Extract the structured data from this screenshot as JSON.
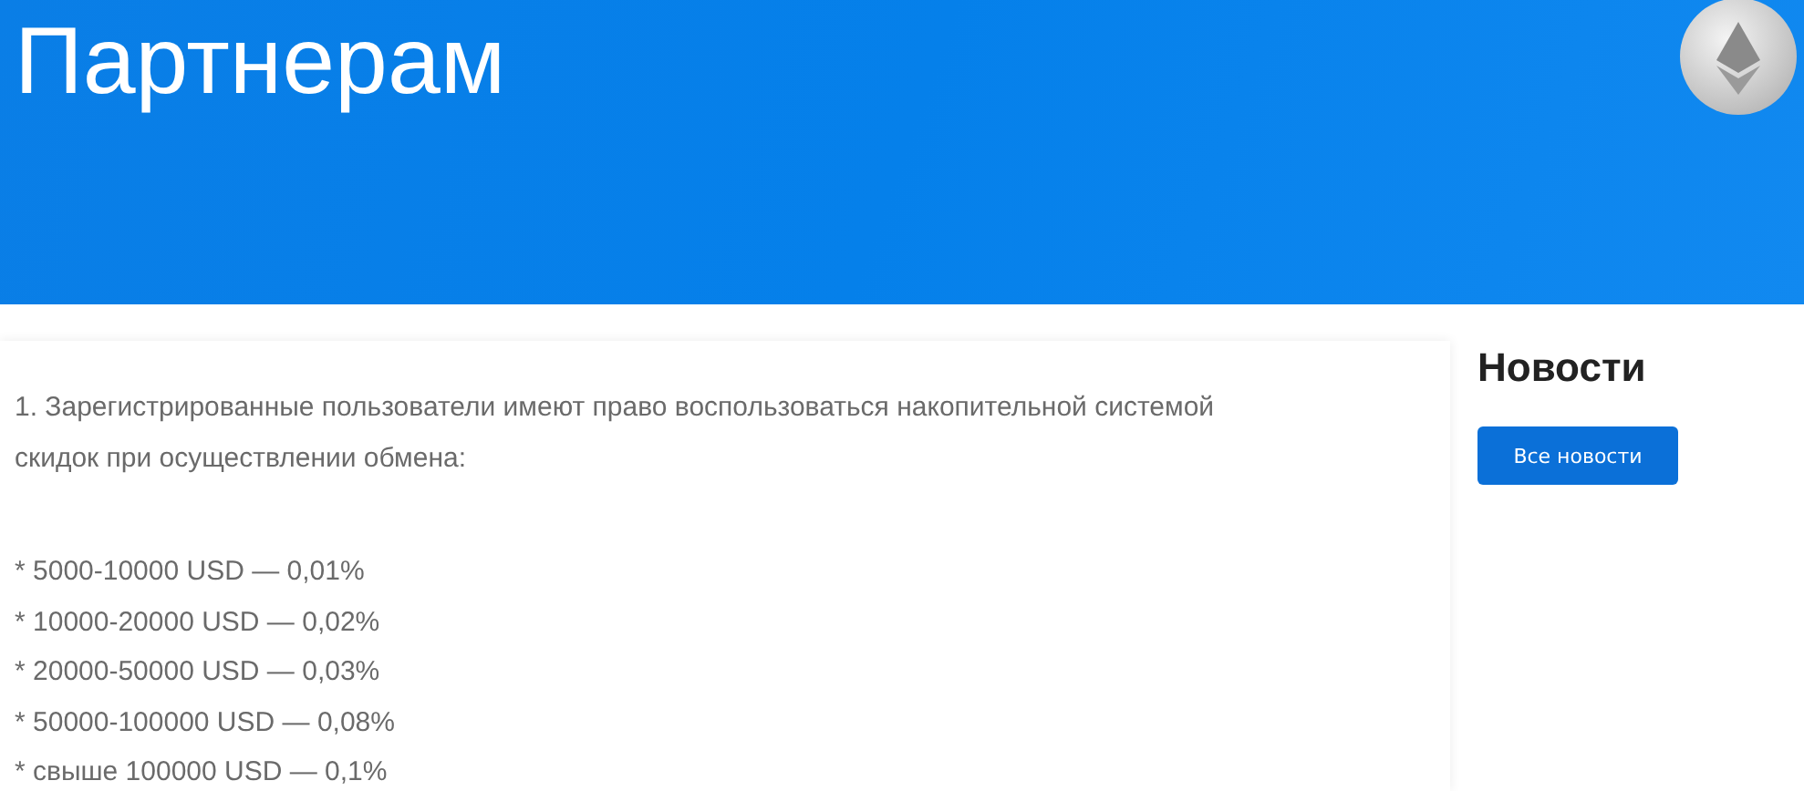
{
  "header": {
    "title": "Партнерам"
  },
  "content": {
    "paragraph": "1. Зарегистрированные пользователи имеют право воспользоваться накопительной системой скидок при осуществлении обмена:",
    "items": [
      "* 5000-10000 USD — 0,01%",
      "* 10000-20000 USD — 0,02%",
      "* 20000-50000 USD — 0,03%",
      "* 50000-100000 USD — 0,08%",
      "* свыше 100000 USD — 0,1%"
    ]
  },
  "sidebar": {
    "title": "Новости",
    "button": "Все новости"
  }
}
